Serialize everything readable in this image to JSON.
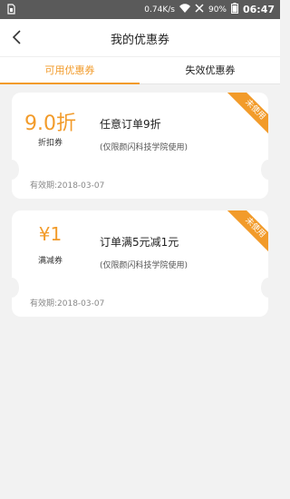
{
  "status_bar": {
    "speed": "0.74K/s",
    "battery": "90%",
    "time": "06:47"
  },
  "header": {
    "title": "我的优惠券",
    "back_icon": "back-chevron-icon"
  },
  "tabs": [
    {
      "label": "可用优惠券",
      "active": true
    },
    {
      "label": "失效优惠券",
      "active": false
    }
  ],
  "accent_color": "#f29b2a",
  "coupons": [
    {
      "value": "9.0折",
      "type": "折扣券",
      "title": "任意订单9折",
      "note": "(仅限颜闪科技学院使用)",
      "expiry": "有效期:2018-03-07",
      "ribbon": "未使用"
    },
    {
      "value": "¥1",
      "type": "满减券",
      "title": "订单满5元减1元",
      "note": "(仅限颜闪科技学院使用)",
      "expiry": "有效期:2018-03-07",
      "ribbon": "未使用"
    }
  ]
}
